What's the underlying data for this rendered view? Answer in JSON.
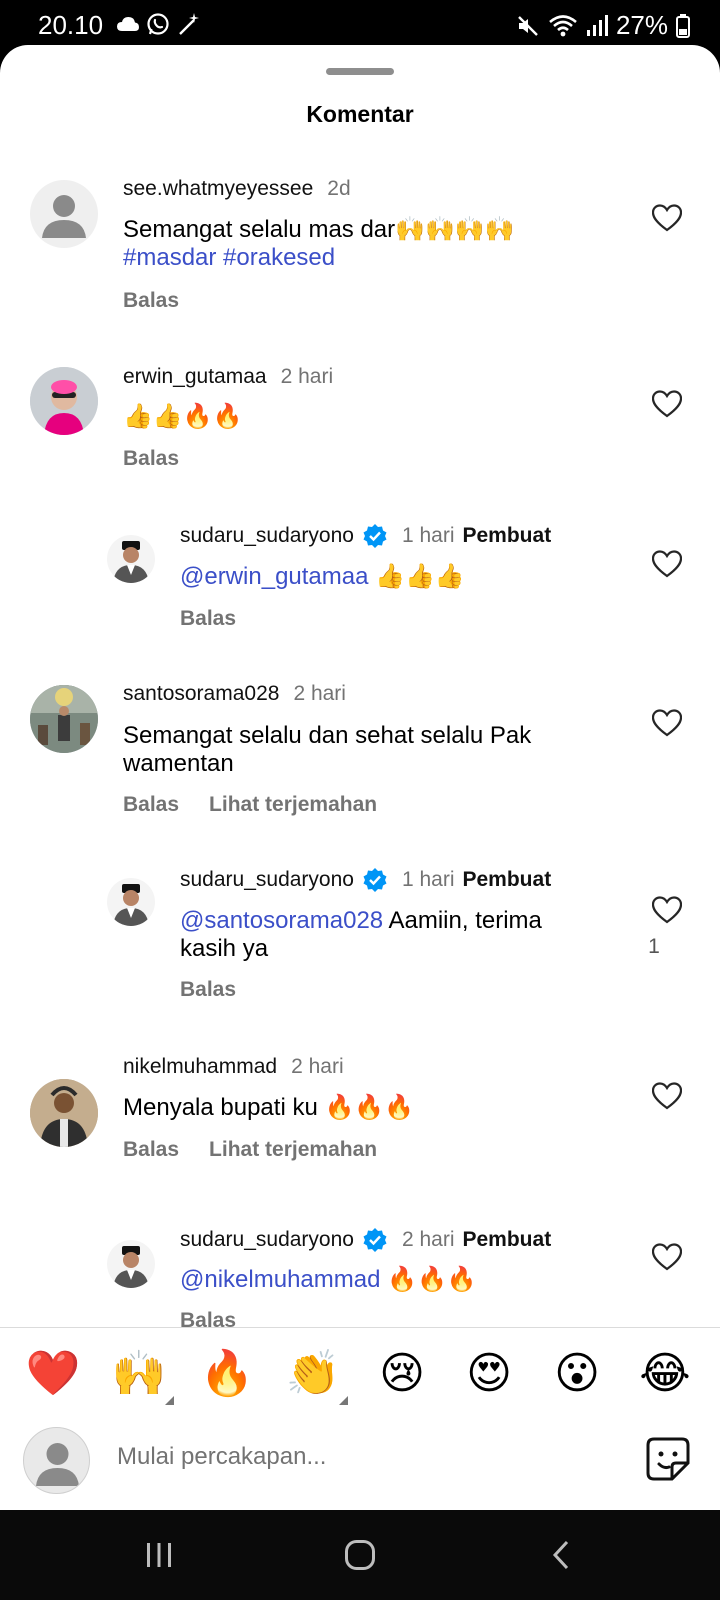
{
  "status": {
    "time": "20.10",
    "battery": "27%"
  },
  "sheet": {
    "title": "Komentar"
  },
  "comments": [
    {
      "username": "see.whatmyeyessee",
      "time": "2d",
      "text": "Semangat selalu mas dar🙌🙌🙌🙌",
      "hashtags": "#masdar #orakesed",
      "reply": "Balas"
    },
    {
      "username": "erwin_gutamaa",
      "time": "2 hari",
      "text": "👍👍🔥🔥",
      "reply": "Balas"
    },
    {
      "username": "sudaru_sudaryono",
      "time": "1 hari",
      "badge": "Pembuat",
      "mention": "@erwin_gutamaa",
      "text": " 👍👍👍",
      "reply": "Balas"
    },
    {
      "username": "santosorama028",
      "time": "2 hari",
      "text": "Semangat selalu dan sehat selalu Pak wamentan",
      "reply": "Balas",
      "translate": "Lihat terjemahan"
    },
    {
      "username": "sudaru_sudaryono",
      "time": "1 hari",
      "badge": "Pembuat",
      "mention": "@santosorama028",
      "text": " Aamiin, terima kasih ya",
      "reply": "Balas",
      "likes": "1"
    },
    {
      "username": "nikelmuhammad",
      "time": "2 hari",
      "text": "Menyala bupati ku 🔥🔥🔥",
      "reply": "Balas",
      "translate": "Lihat terjemahan"
    },
    {
      "username": "sudaru_sudaryono",
      "time": "2 hari",
      "badge": "Pembuat",
      "mention": "@nikelmuhammad",
      "text": " 🔥🔥🔥",
      "reply": "Balas"
    }
  ],
  "reactions": [
    "❤️",
    "🙌",
    "🔥",
    "👏",
    "😢",
    "😍",
    "😮",
    "😂"
  ],
  "composer": {
    "placeholder": "Mulai percakapan..."
  },
  "icons": {
    "heart": "heart-outline-icon",
    "verified": "verified-badge-icon",
    "sticker": "sticker-icon",
    "nav": [
      "recent-apps-icon",
      "home-icon",
      "back-icon"
    ]
  },
  "colors": {
    "mention": "#3b4fc8",
    "verified": "#0095f6",
    "secondary_text": "#737373"
  }
}
